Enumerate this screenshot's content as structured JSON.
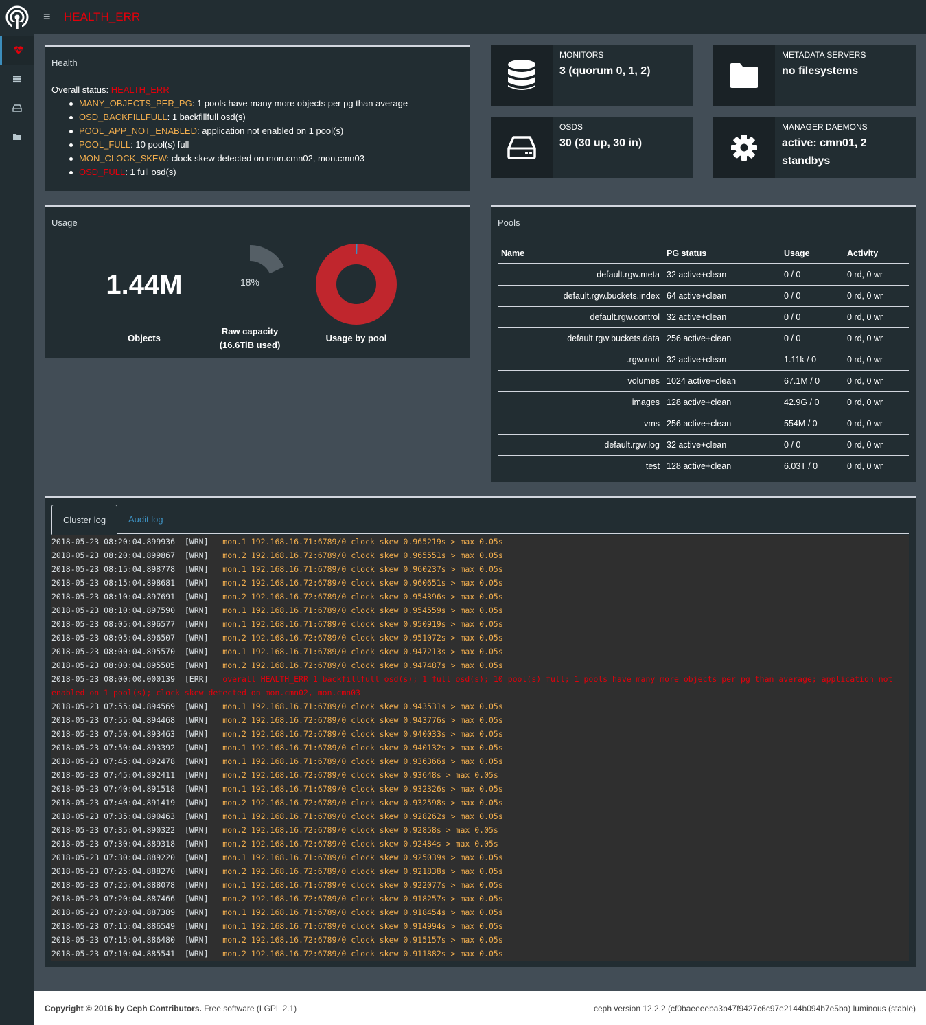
{
  "header": {
    "status": "HEALTH_ERR",
    "menu_icon": "hamburger-icon",
    "logo_icon": "ceph-logo-icon"
  },
  "sidebar": {
    "items": [
      {
        "icon": "heartbeat-icon",
        "active": true
      },
      {
        "icon": "server-icon",
        "active": false
      },
      {
        "icon": "hdd-icon",
        "active": false
      },
      {
        "icon": "folder-icon",
        "active": false
      }
    ]
  },
  "health": {
    "title": "Health",
    "overall_label": "Overall status: ",
    "overall_value": "HEALTH_ERR",
    "checks": [
      {
        "code": "MANY_OBJECTS_PER_PG",
        "level": "warn",
        "message": ": 1 pools have many more objects per pg than average"
      },
      {
        "code": "OSD_BACKFILLFULL",
        "level": "warn",
        "message": ": 1 backfillfull osd(s)"
      },
      {
        "code": "POOL_APP_NOT_ENABLED",
        "level": "warn",
        "message": ": application not enabled on 1 pool(s)"
      },
      {
        "code": "POOL_FULL",
        "level": "warn",
        "message": ": 10 pool(s) full"
      },
      {
        "code": "MON_CLOCK_SKEW",
        "level": "warn",
        "message": ": clock skew detected on mon.cmn02, mon.cmn03"
      },
      {
        "code": "OSD_FULL",
        "level": "err",
        "message": ": 1 full osd(s)"
      }
    ]
  },
  "infoboxes": {
    "monitors": {
      "label": "MONITORS",
      "value": "3 (quorum 0, 1, 2)",
      "icon": "database-icon"
    },
    "mds": {
      "label": "METADATA SERVERS",
      "value": "no filesystems",
      "icon": "folder-icon"
    },
    "osds": {
      "label": "OSDS",
      "value": "30 (30 up, 30 in)",
      "icon": "hdd-icon"
    },
    "mgr": {
      "label": "MANAGER DAEMONS",
      "value": "active: cmn01, 2 standbys",
      "icon": "gear-icon"
    }
  },
  "usage": {
    "title": "Usage",
    "objects_value": "1.44M",
    "objects_label": "Objects",
    "raw_percent_text": "18%",
    "raw_percent": 18,
    "raw_label_1": "Raw capacity",
    "raw_label_2": "(16.6TiB used)",
    "pool_label": "Usage by pool",
    "colors": {
      "gauge": "#555f66",
      "pool_main": "#c0262d",
      "pool_minor": "#3c8dbc"
    }
  },
  "pools": {
    "title": "Pools",
    "columns": [
      "Name",
      "PG status",
      "Usage",
      "Activity"
    ],
    "rows": [
      {
        "name": "default.rgw.meta",
        "pg": "32 active+clean",
        "usage": "0 / 0",
        "activity": "0 rd, 0 wr"
      },
      {
        "name": "default.rgw.buckets.index",
        "pg": "64 active+clean",
        "usage": "0 / 0",
        "activity": "0 rd, 0 wr"
      },
      {
        "name": "default.rgw.control",
        "pg": "32 active+clean",
        "usage": "0 / 0",
        "activity": "0 rd, 0 wr"
      },
      {
        "name": "default.rgw.buckets.data",
        "pg": "256 active+clean",
        "usage": "0 / 0",
        "activity": "0 rd, 0 wr"
      },
      {
        "name": ".rgw.root",
        "pg": "32 active+clean",
        "usage": "1.11k / 0",
        "activity": "0 rd, 0 wr"
      },
      {
        "name": "volumes",
        "pg": "1024 active+clean",
        "usage": "67.1M / 0",
        "activity": "0 rd, 0 wr"
      },
      {
        "name": "images",
        "pg": "128 active+clean",
        "usage": "42.9G / 0",
        "activity": "0 rd, 0 wr"
      },
      {
        "name": "vms",
        "pg": "256 active+clean",
        "usage": "554M / 0",
        "activity": "0 rd, 0 wr"
      },
      {
        "name": "default.rgw.log",
        "pg": "32 active+clean",
        "usage": "0 / 0",
        "activity": "0 rd, 0 wr"
      },
      {
        "name": "test",
        "pg": "128 active+clean",
        "usage": "6.03T / 0",
        "activity": "0 rd, 0 wr"
      }
    ]
  },
  "log": {
    "tabs": [
      "Cluster log",
      "Audit log"
    ],
    "lines": [
      {
        "ts": "2018-05-23 08:20:04.899936",
        "level": "[WRN]",
        "msg": "mon.1 192.168.16.71:6789/0 clock skew 0.965219s > max 0.05s"
      },
      {
        "ts": "2018-05-23 08:20:04.899867",
        "level": "[WRN]",
        "msg": "mon.2 192.168.16.72:6789/0 clock skew 0.965551s > max 0.05s"
      },
      {
        "ts": "2018-05-23 08:15:04.898778",
        "level": "[WRN]",
        "msg": "mon.1 192.168.16.71:6789/0 clock skew 0.960237s > max 0.05s"
      },
      {
        "ts": "2018-05-23 08:15:04.898681",
        "level": "[WRN]",
        "msg": "mon.2 192.168.16.72:6789/0 clock skew 0.960651s > max 0.05s"
      },
      {
        "ts": "2018-05-23 08:10:04.897691",
        "level": "[WRN]",
        "msg": "mon.2 192.168.16.72:6789/0 clock skew 0.954396s > max 0.05s"
      },
      {
        "ts": "2018-05-23 08:10:04.897590",
        "level": "[WRN]",
        "msg": "mon.1 192.168.16.71:6789/0 clock skew 0.954559s > max 0.05s"
      },
      {
        "ts": "2018-05-23 08:05:04.896577",
        "level": "[WRN]",
        "msg": "mon.1 192.168.16.71:6789/0 clock skew 0.950919s > max 0.05s"
      },
      {
        "ts": "2018-05-23 08:05:04.896507",
        "level": "[WRN]",
        "msg": "mon.2 192.168.16.72:6789/0 clock skew 0.951072s > max 0.05s"
      },
      {
        "ts": "2018-05-23 08:00:04.895570",
        "level": "[WRN]",
        "msg": "mon.1 192.168.16.71:6789/0 clock skew 0.947213s > max 0.05s"
      },
      {
        "ts": "2018-05-23 08:00:04.895505",
        "level": "[WRN]",
        "msg": "mon.2 192.168.16.72:6789/0 clock skew 0.947487s > max 0.05s"
      },
      {
        "ts": "2018-05-23 08:00:00.000139",
        "level": "[ERR]",
        "msg": "overall HEALTH_ERR 1 backfillfull osd(s); 1 full osd(s); 10 pool(s) full; 1 pools have many more objects per pg than average; application not enabled on 1 pool(s); clock skew detected on mon.cmn02, mon.cmn03"
      },
      {
        "ts": "2018-05-23 07:55:04.894569",
        "level": "[WRN]",
        "msg": "mon.1 192.168.16.71:6789/0 clock skew 0.943531s > max 0.05s"
      },
      {
        "ts": "2018-05-23 07:55:04.894468",
        "level": "[WRN]",
        "msg": "mon.2 192.168.16.72:6789/0 clock skew 0.943776s > max 0.05s"
      },
      {
        "ts": "2018-05-23 07:50:04.893463",
        "level": "[WRN]",
        "msg": "mon.2 192.168.16.72:6789/0 clock skew 0.940033s > max 0.05s"
      },
      {
        "ts": "2018-05-23 07:50:04.893392",
        "level": "[WRN]",
        "msg": "mon.1 192.168.16.71:6789/0 clock skew 0.940132s > max 0.05s"
      },
      {
        "ts": "2018-05-23 07:45:04.892478",
        "level": "[WRN]",
        "msg": "mon.1 192.168.16.71:6789/0 clock skew 0.936366s > max 0.05s"
      },
      {
        "ts": "2018-05-23 07:45:04.892411",
        "level": "[WRN]",
        "msg": "mon.2 192.168.16.72:6789/0 clock skew 0.93648s > max 0.05s"
      },
      {
        "ts": "2018-05-23 07:40:04.891518",
        "level": "[WRN]",
        "msg": "mon.1 192.168.16.71:6789/0 clock skew 0.932326s > max 0.05s"
      },
      {
        "ts": "2018-05-23 07:40:04.891419",
        "level": "[WRN]",
        "msg": "mon.2 192.168.16.72:6789/0 clock skew 0.932598s > max 0.05s"
      },
      {
        "ts": "2018-05-23 07:35:04.890463",
        "level": "[WRN]",
        "msg": "mon.1 192.168.16.71:6789/0 clock skew 0.928262s > max 0.05s"
      },
      {
        "ts": "2018-05-23 07:35:04.890322",
        "level": "[WRN]",
        "msg": "mon.2 192.168.16.72:6789/0 clock skew 0.92858s > max 0.05s"
      },
      {
        "ts": "2018-05-23 07:30:04.889318",
        "level": "[WRN]",
        "msg": "mon.2 192.168.16.72:6789/0 clock skew 0.92484s > max 0.05s"
      },
      {
        "ts": "2018-05-23 07:30:04.889220",
        "level": "[WRN]",
        "msg": "mon.1 192.168.16.71:6789/0 clock skew 0.925039s > max 0.05s"
      },
      {
        "ts": "2018-05-23 07:25:04.888270",
        "level": "[WRN]",
        "msg": "mon.2 192.168.16.72:6789/0 clock skew 0.921838s > max 0.05s"
      },
      {
        "ts": "2018-05-23 07:25:04.888078",
        "level": "[WRN]",
        "msg": "mon.1 192.168.16.71:6789/0 clock skew 0.922077s > max 0.05s"
      },
      {
        "ts": "2018-05-23 07:20:04.887466",
        "level": "[WRN]",
        "msg": "mon.2 192.168.16.72:6789/0 clock skew 0.918257s > max 0.05s"
      },
      {
        "ts": "2018-05-23 07:20:04.887389",
        "level": "[WRN]",
        "msg": "mon.1 192.168.16.71:6789/0 clock skew 0.918454s > max 0.05s"
      },
      {
        "ts": "2018-05-23 07:15:04.886549",
        "level": "[WRN]",
        "msg": "mon.1 192.168.16.71:6789/0 clock skew 0.914994s > max 0.05s"
      },
      {
        "ts": "2018-05-23 07:15:04.886480",
        "level": "[WRN]",
        "msg": "mon.2 192.168.16.72:6789/0 clock skew 0.915157s > max 0.05s"
      },
      {
        "ts": "2018-05-23 07:10:04.885541",
        "level": "[WRN]",
        "msg": "mon.2 192.168.16.72:6789/0 clock skew 0.911882s > max 0.05s"
      }
    ]
  },
  "footer": {
    "copyright": "Copyright © 2016 by Ceph Contributors.",
    "license": " Free software (LGPL 2.1)",
    "version": "ceph version 12.2.2 (cf0baeeeeba3b47f9427c6c97e2144b094b7e5ba) luminous (stable)"
  }
}
